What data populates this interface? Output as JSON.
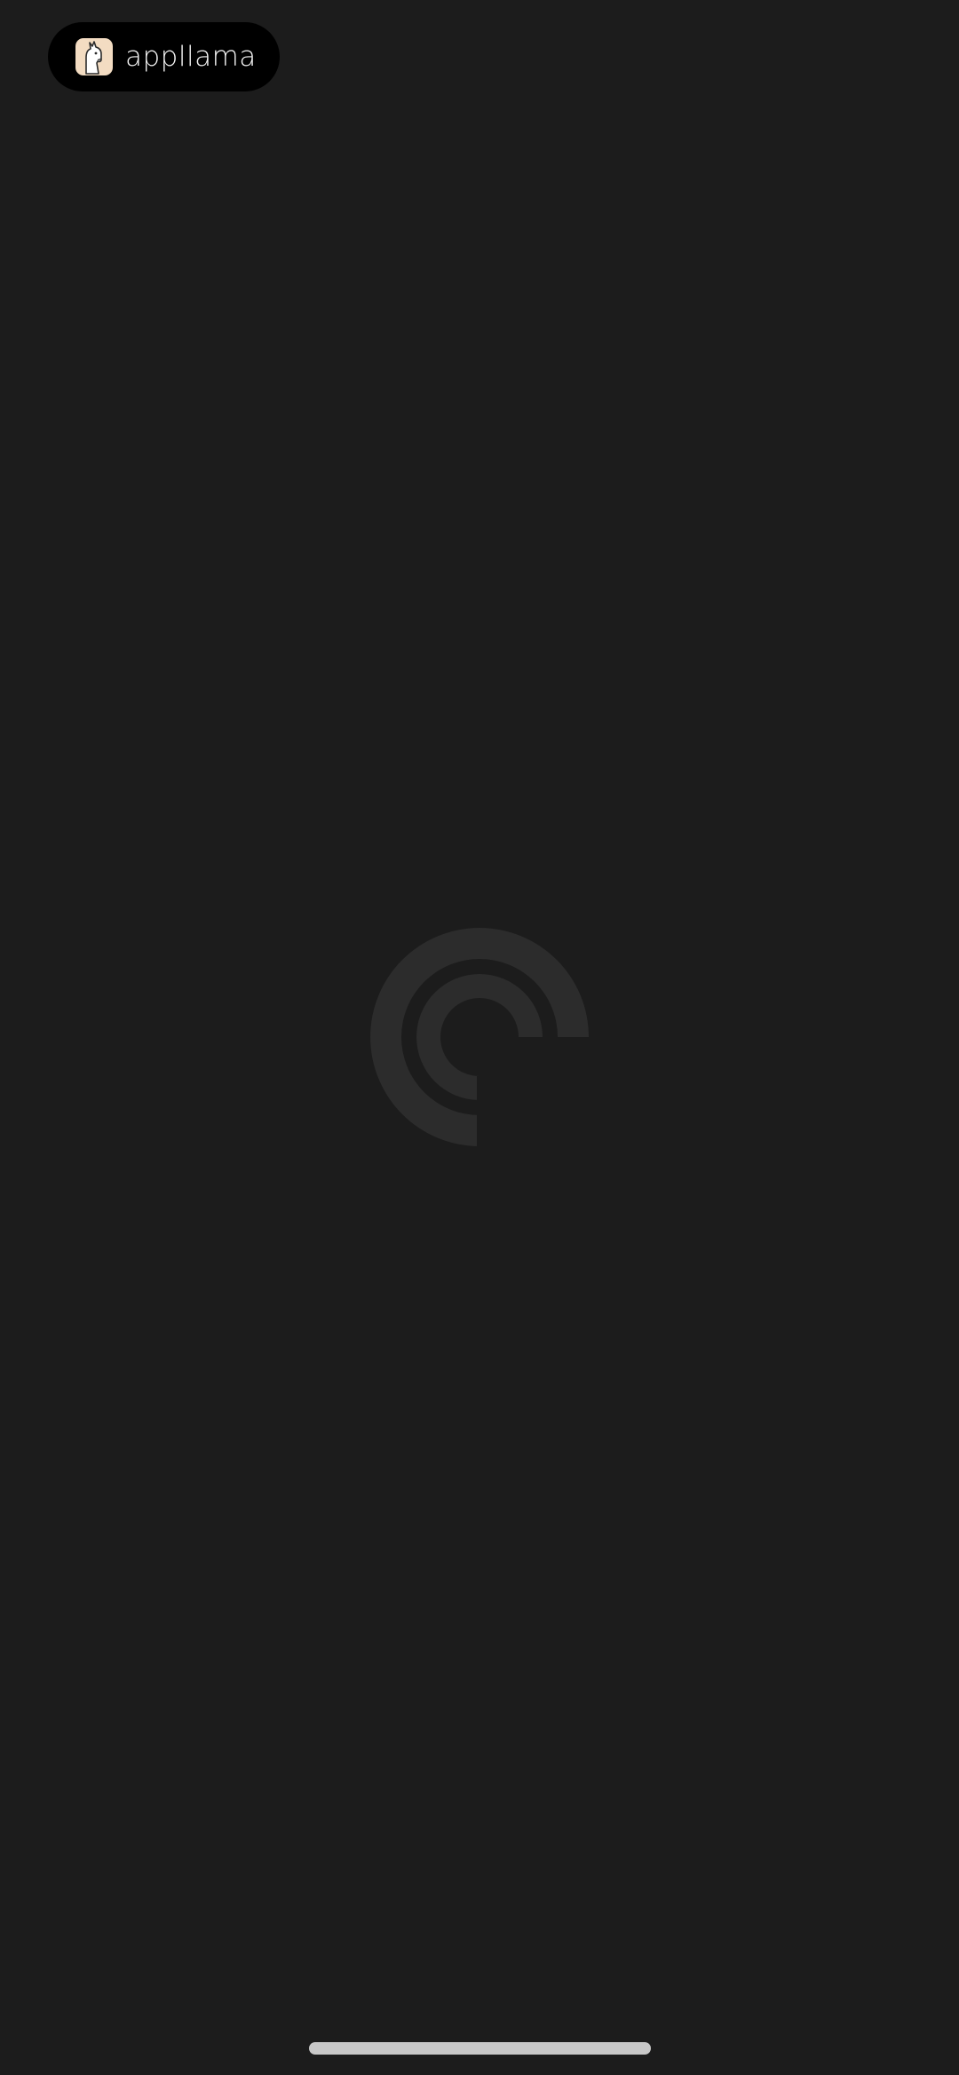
{
  "app_badge": {
    "icon": "llama-icon",
    "name": "appllama"
  },
  "loading": {
    "icon": "loading-spinner-icon"
  },
  "colors": {
    "background": "#1c1c1c",
    "pill": "#000000",
    "spinner": "#2c2c2c",
    "home_indicator": "#c8c8c8"
  }
}
